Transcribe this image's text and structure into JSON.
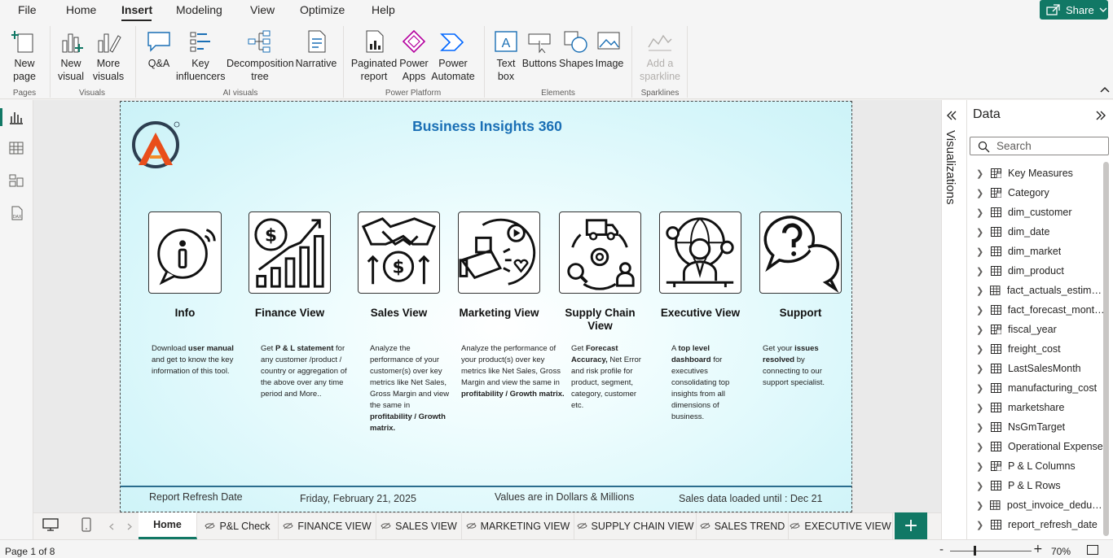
{
  "menu": {
    "items": [
      "File",
      "Home",
      "Insert",
      "Modeling",
      "View",
      "Optimize",
      "Help"
    ],
    "active": "Insert",
    "share_label": "Share"
  },
  "ribbon": {
    "new_page": "New page",
    "new_visual": "New visual",
    "more_visuals": "More visuals",
    "qa": "Q&A",
    "key_influencers": "Key influencers",
    "decomposition_tree": "Decomposition tree",
    "narrative": "Narrative",
    "paginated_report": "Paginated report",
    "power_apps": "Power Apps",
    "power_automate": "Power Automate",
    "text_box": "Text box",
    "buttons": "Buttons",
    "shapes": "Shapes",
    "image": "Image",
    "add_sparkline": "Add a sparkline",
    "groups": {
      "pages": "Pages",
      "visuals": "Visuals",
      "ai_visuals": "AI visuals",
      "power_platform": "Power Platform",
      "elements": "Elements",
      "sparklines": "Sparklines"
    }
  },
  "report": {
    "title": "Business Insights 360",
    "cards": [
      {
        "title": "Info",
        "icon": "info-icon"
      },
      {
        "title": "Finance View",
        "icon": "finance-chart-icon"
      },
      {
        "title": "Sales View",
        "icon": "handshake-icon"
      },
      {
        "title": "Marketing View",
        "icon": "megaphone-icon"
      },
      {
        "title": "Supply Chain View",
        "icon": "supply-chain-icon"
      },
      {
        "title": "Executive View",
        "icon": "executive-icon"
      },
      {
        "title": "Support",
        "icon": "support-chat-icon"
      }
    ],
    "descriptions": {
      "info": {
        "a": "Download ",
        "b": "user manual",
        "c": " and get to know the key information of this tool."
      },
      "finance": {
        "a": "Get  ",
        "b": "P & L statement",
        "c": " for any customer /product / country or aggregation of the above over any time period and More.."
      },
      "sales": {
        "a": "Analyze the performance of your customer(s) over key metrics like Net Sales, Gross Margin and view the same in ",
        "b": "profitability / Growth matrix."
      },
      "marketing": {
        "a": "Analyze the performance of your product(s) over key metrics like Net Sales, Gross Margin and view the same in ",
        "b": "profitability / Growth matrix."
      },
      "supply": {
        "a": "Get ",
        "b": "Forecast Accuracy,",
        "c": " Net Error and risk profile for product, segment, category, customer etc."
      },
      "executive": {
        "a": "A ",
        "b": "top level dashboard",
        "c": " for executives consolidating top insights from all dimensions of business."
      },
      "support": {
        "a": "Get your ",
        "b": "issues resolved",
        "c": " by connecting to our support specialist."
      }
    },
    "footer": {
      "refresh_label": "Report Refresh Date",
      "refresh_date": "Friday, February 21, 2025",
      "units": "Values are in Dollars & Millions",
      "loaded": "Sales data loaded until : Dec 21"
    },
    "colors": {
      "title": "#1a6fb5",
      "accent": "#117865"
    }
  },
  "panes": {
    "visualizations_label": "Visualizations",
    "data_title": "Data",
    "search_placeholder": "Search",
    "fields": [
      "Key Measures",
      "Category",
      "dim_customer",
      "dim_date",
      "dim_market",
      "dim_product",
      "fact_actuals_estimates",
      "fact_forecast_monthly",
      "fiscal_year",
      "freight_cost",
      "LastSalesMonth",
      "manufacturing_cost",
      "marketshare",
      "NsGmTarget",
      "Operational Expense",
      "P & L Columns",
      "P & L Rows",
      "post_invoice_deducti...",
      "report_refresh_date"
    ]
  },
  "tabs": {
    "items": [
      "Home",
      "P&L Check",
      "FINANCE VIEW",
      "SALES VIEW",
      "MARKETING VIEW",
      "SUPPLY CHAIN VIEW",
      "SALES TREND",
      "EXECUTIVE VIEW"
    ],
    "active": "Home",
    "add_label": "+"
  },
  "status": {
    "page": "Page 1 of 8",
    "zoom": "70%"
  }
}
